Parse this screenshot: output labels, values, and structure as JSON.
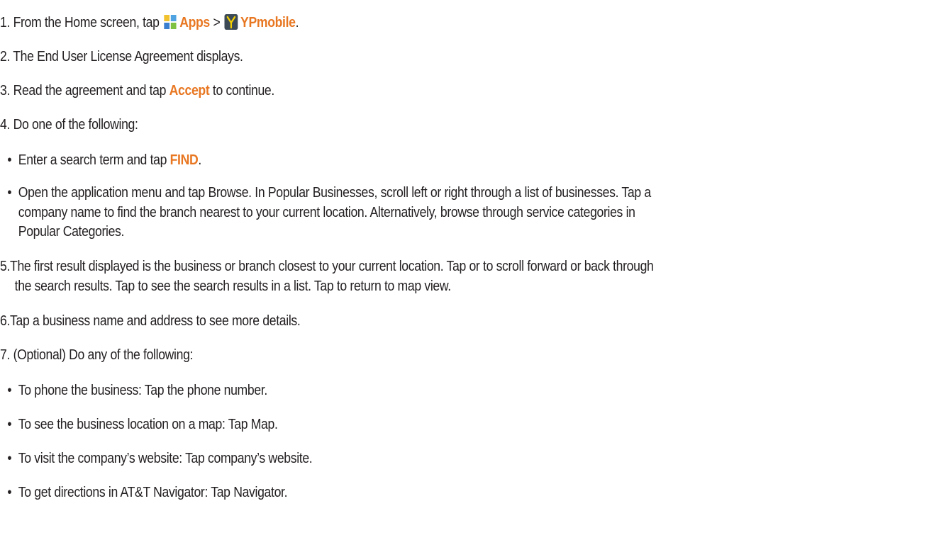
{
  "steps": [
    {
      "num": "1.",
      "pre": "From the Home screen, tap ",
      "apps_icon": "apps-grid-icon",
      "apps": "Apps",
      "sep": " > ",
      "yp_icon": "ypmobile-app-icon",
      "ypmobile": "YPmobile",
      "post": "."
    },
    {
      "num": "2.",
      "text": "The End User License Agreement displays."
    },
    {
      "num": "3.",
      "pre": "Read the agreement and tap ",
      "accept": "Accept",
      "post": " to continue."
    },
    {
      "num": "4.",
      "text": "Do one of the following:"
    },
    {
      "num": "5.",
      "text1": "The first result displayed is the business or branch closest to your current location. Tap or to scroll forward or back through",
      "text2": "the search results. Tap to see the search results in a list. Tap to return to map view."
    },
    {
      "num": "6.",
      "text": "Tap a business name and address to see more details."
    },
    {
      "num": "7.",
      "text": "(Optional) Do any of the following:"
    }
  ],
  "bullets4": [
    {
      "pre": "Enter a search term and tap ",
      "find": "FIND",
      "post": "."
    },
    {
      "text1": "Open the application menu and tap Browse. In Popular Businesses, scroll left or right through a list of businesses. Tap a",
      "text2": "company name to find the branch nearest to your current location. Alternatively, browse through service categories in",
      "text3": "Popular Categories."
    }
  ],
  "bullets7": [
    "To phone the business: Tap the phone number.",
    "To see the business location on a map: Tap Map.",
    "To visit the company’s website: Tap company’s website.",
    "To get directions in AT&T Navigator: Tap Navigator."
  ],
  "bullet_char": "•",
  "colors": {
    "accent": "#e87722",
    "text": "#231f20"
  }
}
